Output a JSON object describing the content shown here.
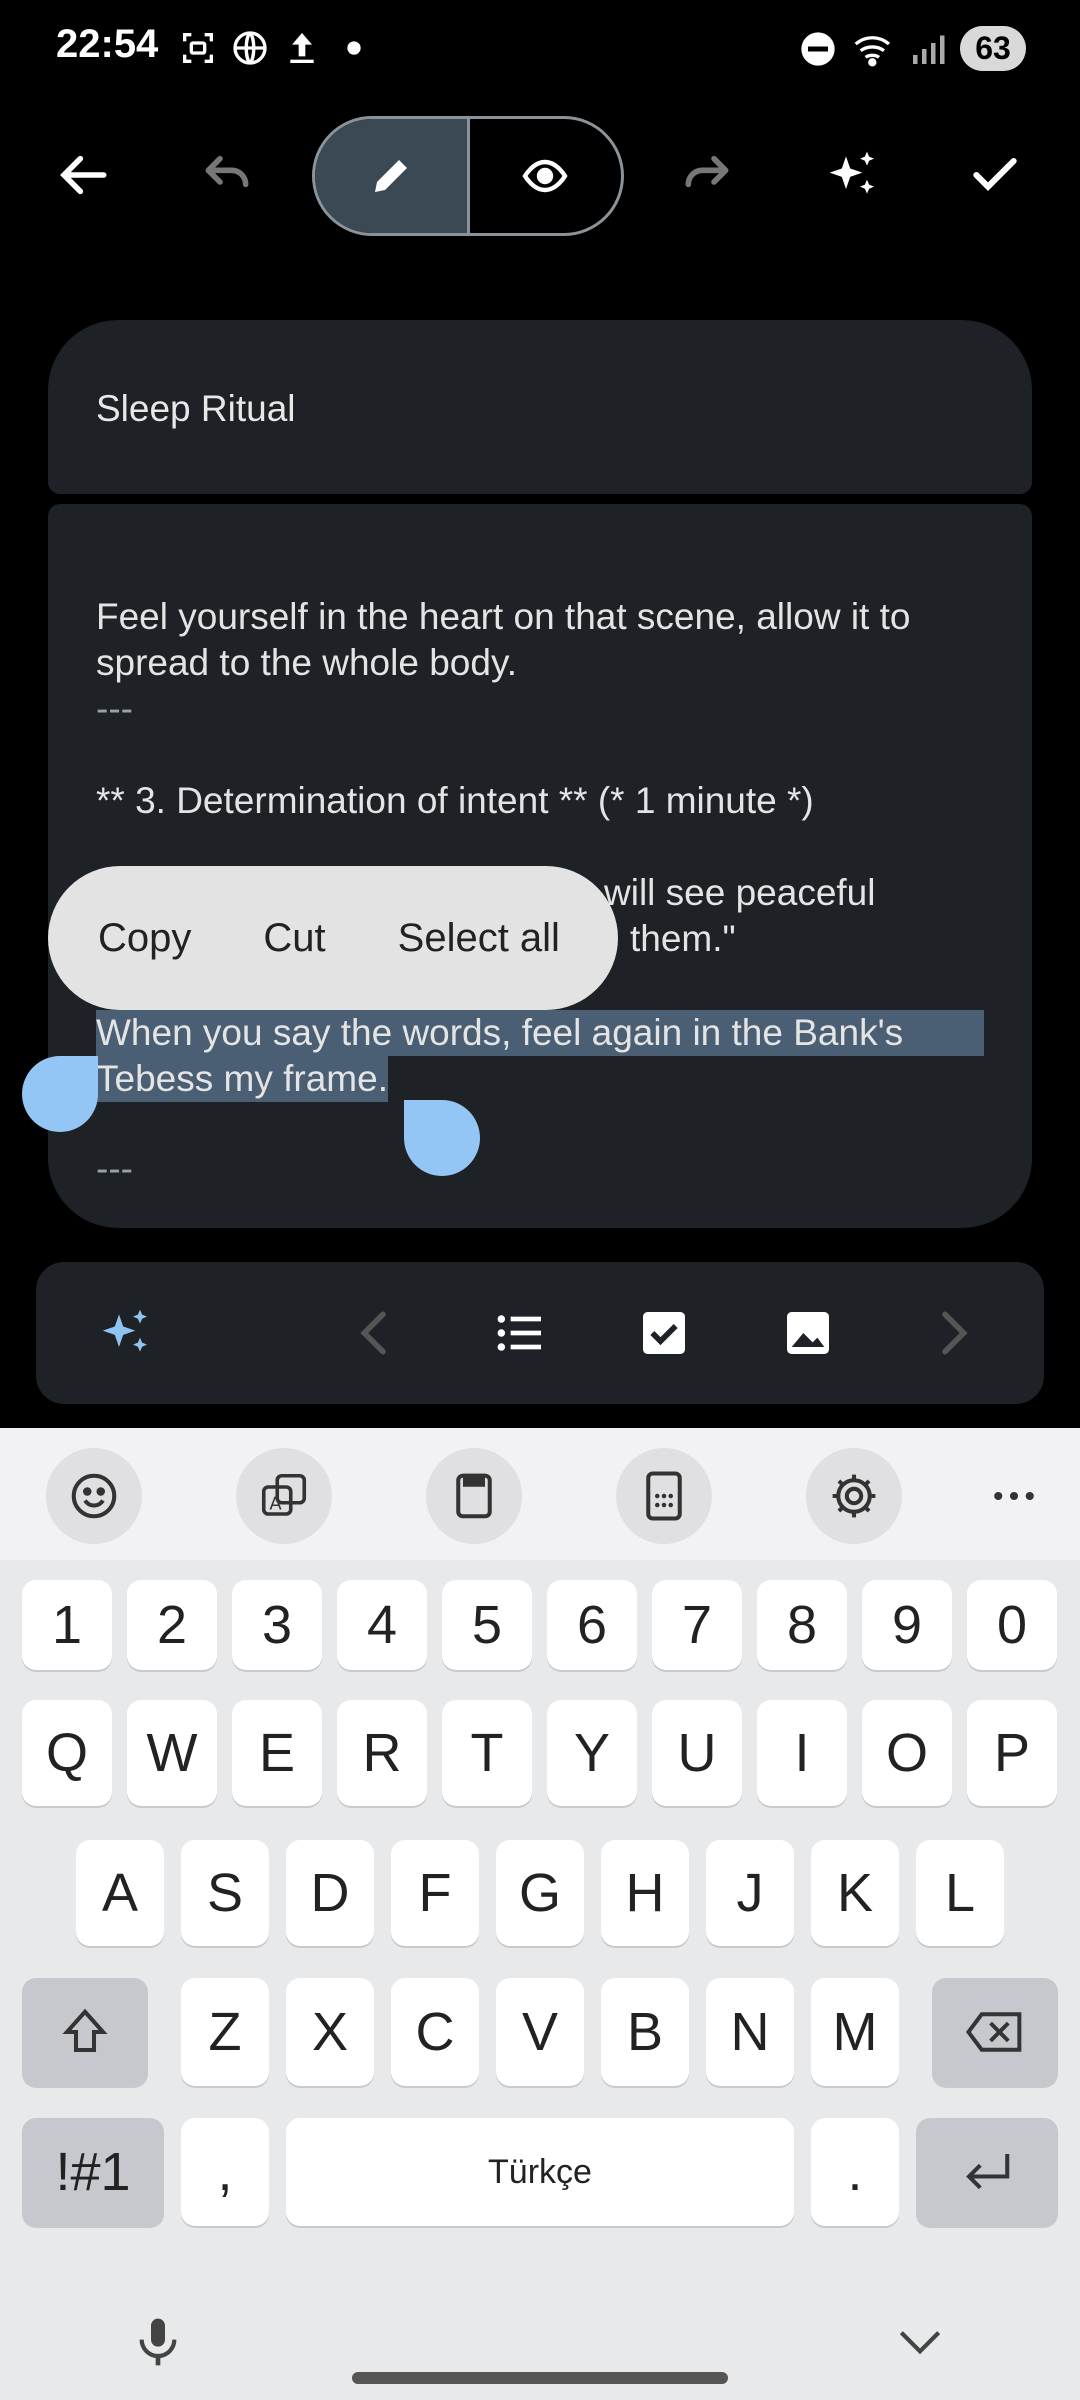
{
  "status_bar": {
    "time": "22:54",
    "battery": "63",
    "icons": [
      "screenshot-icon",
      "globe-icon",
      "upload-icon",
      "dot-icon",
      "dnd-icon",
      "wifi-icon",
      "signal-icon"
    ]
  },
  "toolbar": {
    "buttons": [
      "back",
      "undo",
      "edit-mode",
      "preview-mode",
      "redo",
      "ai-assist",
      "done"
    ]
  },
  "note": {
    "title": "Sleep Ritual",
    "lines": [
      "Feel yourself in the heart on that scene, allow it to",
      "spread to the whole body.",
      "---",
      "** 3. Determination of intent ** (* 1 minute *)",
      "will see peaceful",
      "them.\"",
      "When you say the words, feel again in the Bank's",
      "Tebess my frame.",
      "---"
    ]
  },
  "context_menu": {
    "copy": "Copy",
    "cut": "Cut",
    "select_all": "Select all"
  },
  "format_bar": {
    "buttons": [
      "ai-sparkle",
      "prev",
      "bullet-list",
      "checkbox",
      "image",
      "next"
    ]
  },
  "keyboard": {
    "language": "Türkçe",
    "row_numbers": [
      "1",
      "2",
      "3",
      "4",
      "5",
      "6",
      "7",
      "8",
      "9",
      "0"
    ],
    "row_1": [
      "Q",
      "W",
      "E",
      "R",
      "T",
      "Y",
      "U",
      "I",
      "O",
      "P"
    ],
    "row_2": [
      "A",
      "S",
      "D",
      "F",
      "G",
      "H",
      "J",
      "K",
      "L"
    ],
    "row_3": [
      "Z",
      "X",
      "C",
      "V",
      "B",
      "N",
      "M"
    ],
    "symbols_key": "!#1",
    "comma_key": ",",
    "period_key": "."
  },
  "colors": {
    "background": "#000000",
    "card": "#1e2125",
    "selection": "#4a5f73",
    "handle": "#93c6f5",
    "context_menu": "#e3e3e3"
  }
}
